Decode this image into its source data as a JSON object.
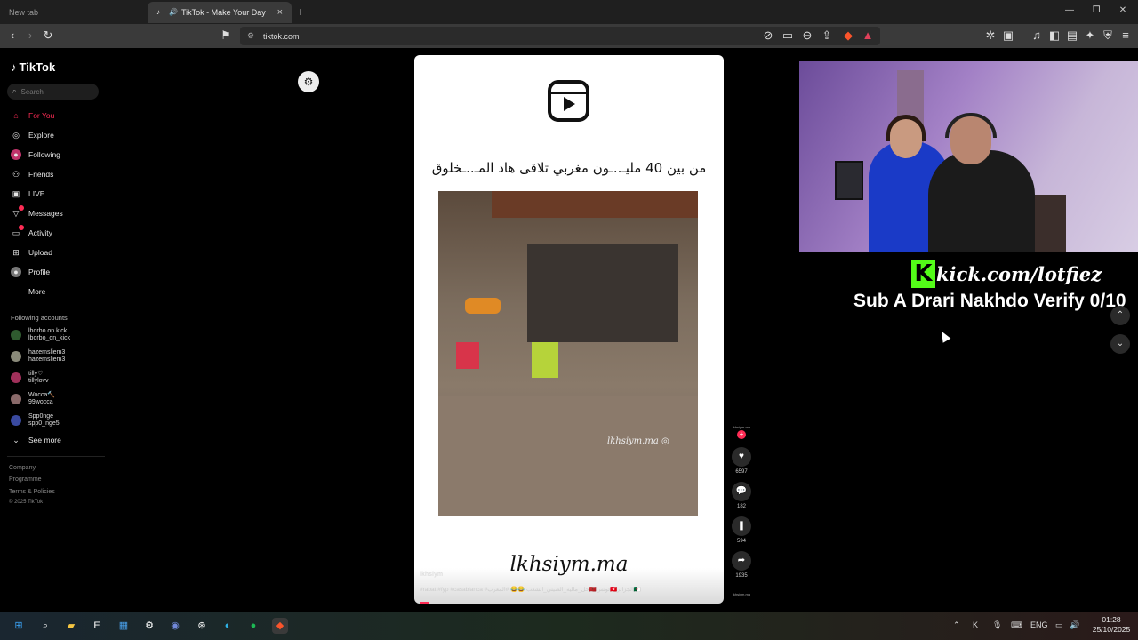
{
  "browser": {
    "tabs": [
      {
        "label": "New tab"
      },
      {
        "label": "TikTok - Make Your Day"
      }
    ],
    "url": "tiktok.com"
  },
  "sidebar": {
    "logo": "TikTok",
    "search_placeholder": "Search",
    "nav": [
      {
        "label": "For You",
        "icon": "home-icon",
        "active": true
      },
      {
        "label": "Explore",
        "icon": "compass-icon"
      },
      {
        "label": "Following",
        "icon": "following-icon"
      },
      {
        "label": "Friends",
        "icon": "friends-icon"
      },
      {
        "label": "LIVE",
        "icon": "live-icon"
      },
      {
        "label": "Messages",
        "icon": "messages-icon",
        "badge": true
      },
      {
        "label": "Activity",
        "icon": "activity-icon",
        "badge": true
      },
      {
        "label": "Upload",
        "icon": "upload-icon"
      },
      {
        "label": "Profile",
        "icon": "profile-icon"
      },
      {
        "label": "More",
        "icon": "more-icon"
      }
    ],
    "following_label": "Following accounts",
    "accounts": [
      {
        "name": "lborbo on kick",
        "handle": "lborbo_on_kick"
      },
      {
        "name": "hazemsliem3",
        "handle": "hazemsliem3"
      },
      {
        "name": "tilly♡",
        "handle": "tillylovv"
      },
      {
        "name": "Wocca🔨",
        "handle": "99wocca"
      },
      {
        "name": "Spp0nge",
        "handle": "spp0_nge5"
      }
    ],
    "see_more": "See more",
    "footer": [
      "Company",
      "Programme",
      "Terms & Policies",
      "© 2025 TikTok"
    ]
  },
  "video": {
    "caption_ar": "من بين 40 مليـ..ـون مغربي تلاقى هاد المـ..ـخلوق",
    "watermark": "lkhsiym.ma",
    "signature": "lkhsiym.ma",
    "author": "lkhsiym",
    "tags": "#rabat #fyp #casablanca #حل_مالية_الصيني_الشعب 😂😂 #المغرب🇲🇦تونس🇹🇳الجزائر🇩🇿",
    "likes": "6597",
    "comments": "182",
    "saves": "594",
    "shares": "1935"
  },
  "stream": {
    "kick_url": "kick.com/lotfiez",
    "sub_goal": "Sub A Drari Nakhdo Verify 0/10"
  },
  "taskbar": {
    "lang": "ENG",
    "time": "01:28",
    "date": "25/10/2025"
  },
  "colors": {
    "accent": "#fe2c55",
    "kick": "#53fc18"
  }
}
